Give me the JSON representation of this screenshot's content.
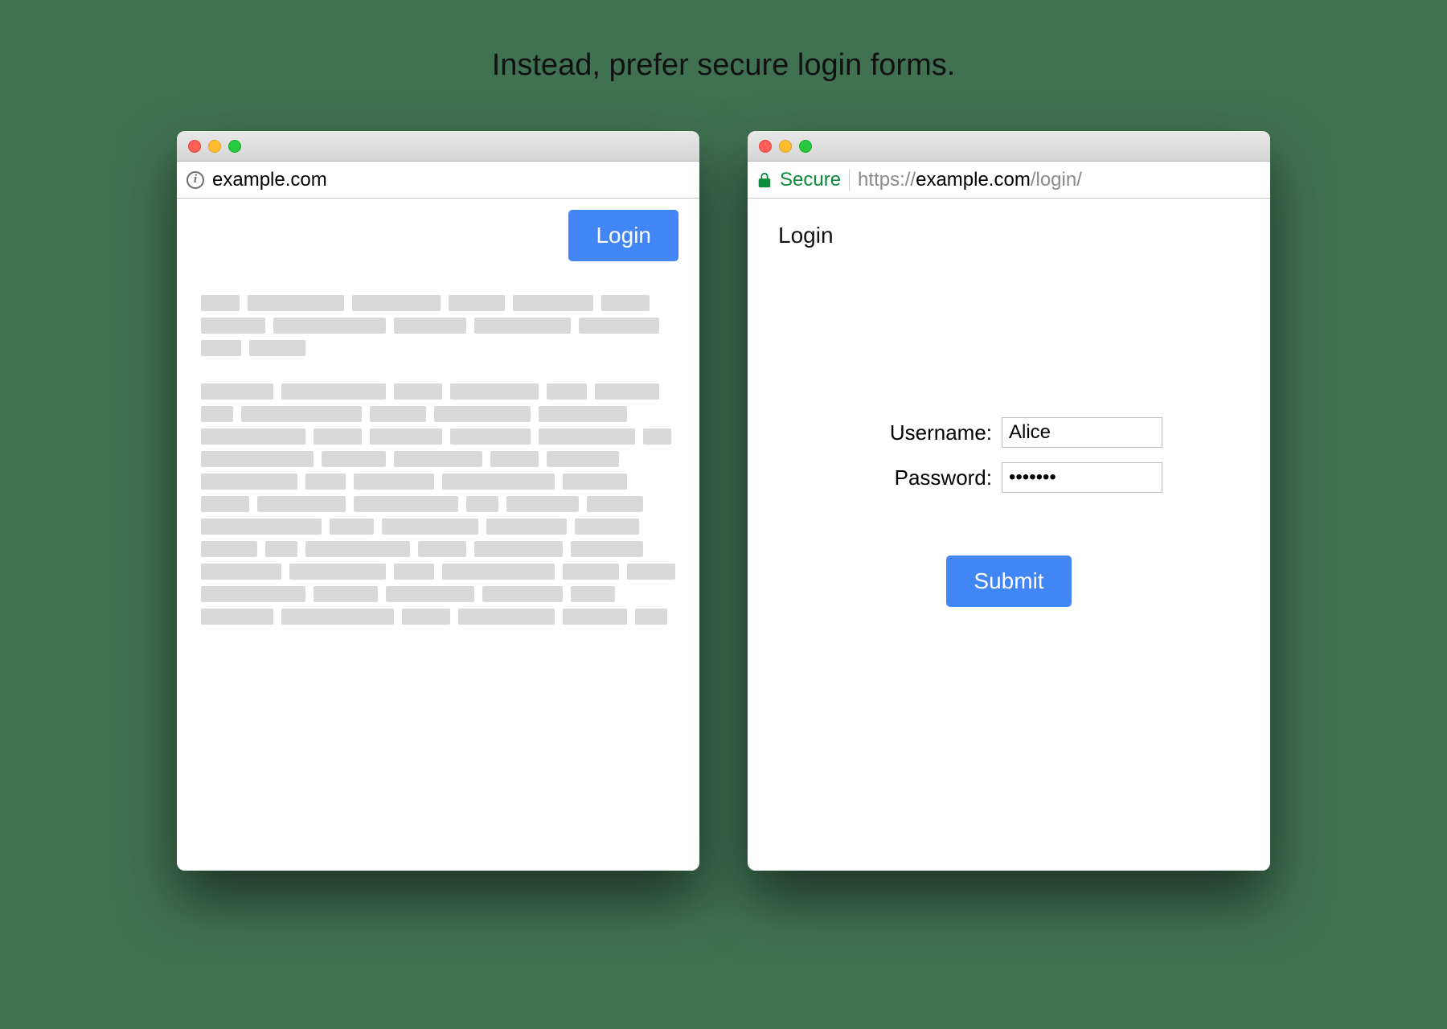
{
  "caption": "Instead, prefer secure login forms.",
  "left": {
    "url_text": "example.com",
    "login_button": "Login"
  },
  "right": {
    "secure_label": "Secure",
    "url_scheme": "https://",
    "url_host": "example.com",
    "url_path": "/login/",
    "heading": "Login",
    "username_label": "Username:",
    "username_value": "Alice",
    "password_label": "Password:",
    "password_value": "•••••••",
    "submit_button": "Submit"
  }
}
